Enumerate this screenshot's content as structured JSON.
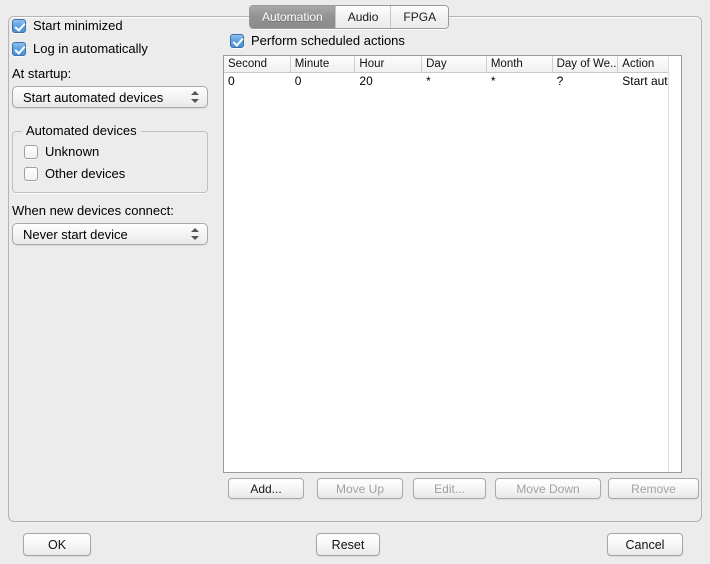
{
  "tabs": [
    {
      "label": "Automation",
      "active": true
    },
    {
      "label": "Audio",
      "active": false
    },
    {
      "label": "FPGA",
      "active": false
    }
  ],
  "left": {
    "start_minimized": {
      "label": "Start minimized",
      "checked": true
    },
    "log_in_automatically": {
      "label": "Log in automatically",
      "checked": true
    },
    "at_startup_label": "At startup:",
    "at_startup_value": "Start automated devices",
    "automated_devices_group": "Automated devices",
    "unknown": {
      "label": "Unknown",
      "checked": false
    },
    "other_devices": {
      "label": "Other devices",
      "checked": false
    },
    "when_connect_label": "When new devices connect:",
    "when_connect_value": "Never start device"
  },
  "right": {
    "perform_scheduled_actions": {
      "label": "Perform scheduled actions",
      "checked": true
    },
    "table": {
      "columns": [
        "Second",
        "Minute",
        "Hour",
        "Day",
        "Month",
        "Day of We...",
        "Action"
      ],
      "rows": [
        [
          "0",
          "0",
          "20",
          "*",
          "*",
          "?",
          "Start aut..."
        ]
      ]
    },
    "buttons": {
      "add": {
        "label": "Add...",
        "enabled": true
      },
      "move_up": {
        "label": "Move Up",
        "enabled": false
      },
      "edit": {
        "label": "Edit...",
        "enabled": false
      },
      "move_down": {
        "label": "Move Down",
        "enabled": false
      },
      "remove": {
        "label": "Remove",
        "enabled": false
      }
    }
  },
  "footer": {
    "ok": "OK",
    "reset": "Reset",
    "cancel": "Cancel"
  }
}
